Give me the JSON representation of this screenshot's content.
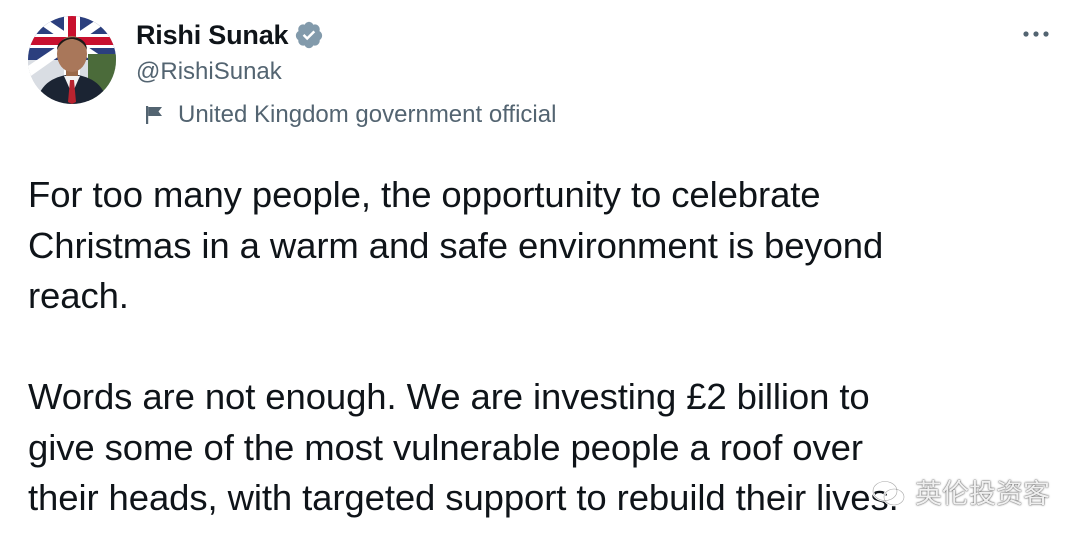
{
  "author": {
    "name": "Rishi Sunak",
    "handle": "@RishiSunak",
    "label": "United Kingdom government official",
    "verified": true
  },
  "icons": {
    "verified": "verified-badge-icon",
    "label": "flag-icon",
    "more": "more-options-icon",
    "watermark": "wechat-icon"
  },
  "tweet": {
    "paragraphs": [
      "For too many people, the opportunity to celebrate\nChristmas in a warm and safe environment is beyond\nreach.",
      "Words are not enough. We are investing £2 billion to\ngive some of the most vulnerable people a roof over\ntheir heads, with targeted support to rebuild their lives."
    ]
  },
  "watermark": {
    "text": "英伦投资客"
  },
  "colors": {
    "text_primary": "#0f1419",
    "text_secondary": "#536471",
    "verified_badge": "#829aab",
    "background": "#ffffff"
  }
}
